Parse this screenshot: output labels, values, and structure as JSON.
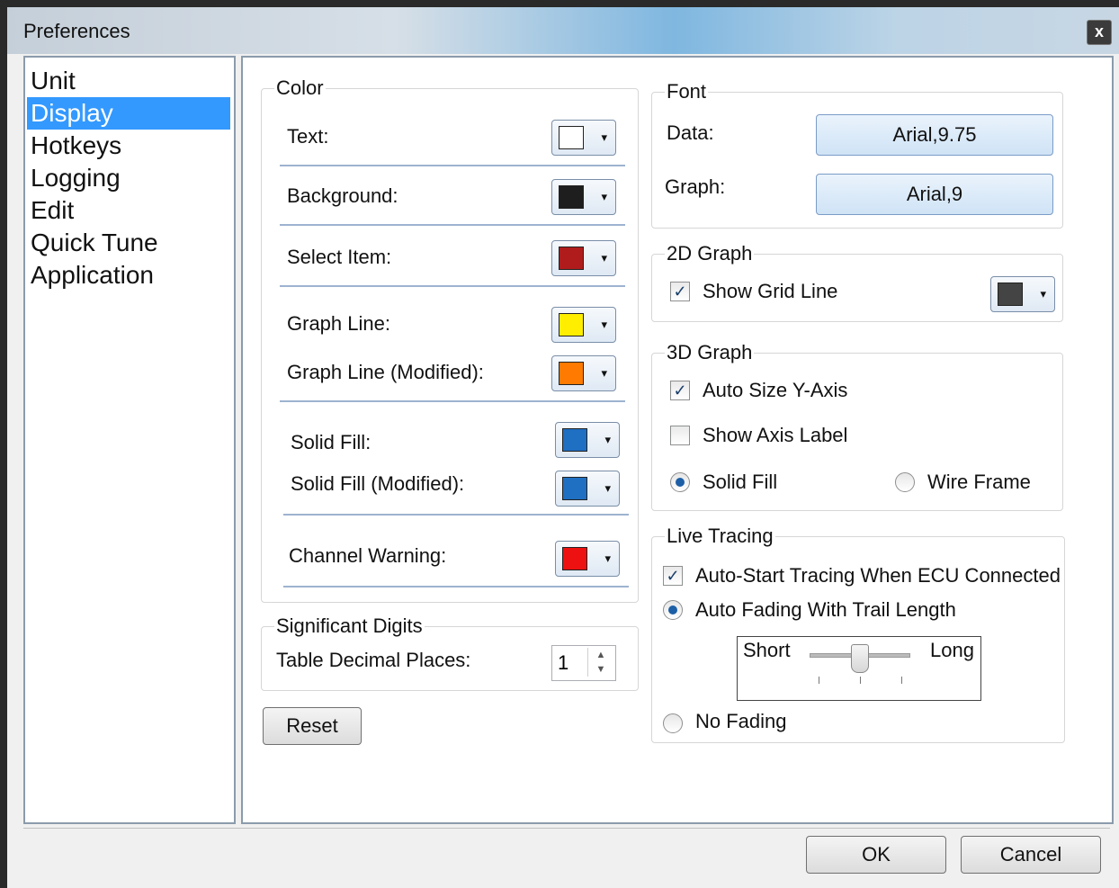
{
  "window": {
    "title": "Preferences",
    "close_label": "x"
  },
  "nav": {
    "items": [
      "Unit",
      "Display",
      "Hotkeys",
      "Logging",
      "Edit",
      "Quick Tune",
      "Application"
    ],
    "selected": "Display"
  },
  "color": {
    "title": "Color",
    "rows": [
      {
        "label": "Text:",
        "color": "#ffffff"
      },
      {
        "label": "Background:",
        "color": "#1e1e1e"
      },
      {
        "label": "Select Item:",
        "color": "#b01c1c"
      },
      {
        "label": "Graph Line:",
        "color": "#ffee00"
      },
      {
        "label": "Graph Line (Modified):",
        "color": "#ff7a00"
      },
      {
        "label": "Solid Fill:",
        "color": "#1f6fc2"
      },
      {
        "label": "Solid Fill (Modified):",
        "color": "#1f6fc2"
      },
      {
        "label": "Channel Warning:",
        "color": "#ee1111"
      }
    ]
  },
  "sigdigits": {
    "title": "Significant Digits",
    "label": "Table Decimal Places:",
    "value": "1"
  },
  "reset_label": "Reset",
  "font": {
    "title": "Font",
    "data_label": "Data:",
    "data_value": "Arial,9.75",
    "graph_label": "Graph:",
    "graph_value": "Arial,9"
  },
  "graph2d": {
    "title": "2D Graph",
    "show_grid": "Show Grid Line",
    "grid_checked": true,
    "grid_color": "#444444"
  },
  "graph3d": {
    "title": "3D Graph",
    "auto_size": "Auto Size Y-Axis",
    "show_axis": "Show Axis Label",
    "solid_fill": "Solid Fill",
    "wire_frame": "Wire Frame"
  },
  "live": {
    "title": "Live Tracing",
    "auto_start": "Auto-Start Tracing When ECU Connected",
    "auto_fading": "Auto Fading With Trail Length",
    "short": "Short",
    "long": "Long",
    "no_fading": "No Fading",
    "trail_level": 0.5
  },
  "buttons": {
    "ok": "OK",
    "cancel": "Cancel"
  },
  "icons": {
    "dropdown": "▾",
    "check": "✓"
  }
}
